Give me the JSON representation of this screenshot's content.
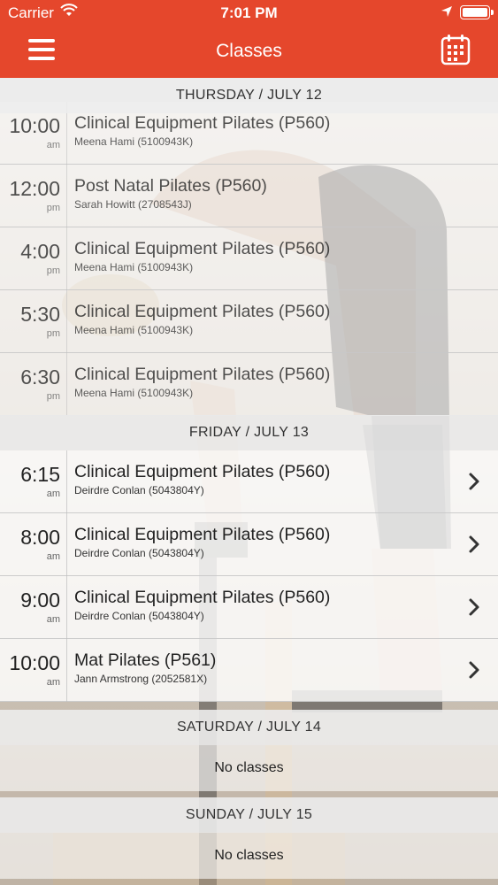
{
  "status_bar": {
    "carrier": "Carrier",
    "time": "7:01 PM"
  },
  "nav": {
    "title": "Classes",
    "accent_color": "#e5472c"
  },
  "icons": {
    "menu": "hamburger-menu-icon",
    "calendar": "calendar-icon",
    "wifi": "wifi-icon",
    "location": "location-arrow-icon",
    "battery": "battery-icon",
    "chevron": "chevron-right-icon"
  },
  "days": [
    {
      "header": "THURSDAY / JULY 12",
      "classes": [
        {
          "time": "10:00",
          "ampm": "am",
          "name": "Clinical Equipment Pilates (P560)",
          "instructor": "Meena Hami (5100943K)",
          "past": true
        },
        {
          "time": "12:00",
          "ampm": "pm",
          "name": "Post Natal Pilates (P560)",
          "instructor": "Sarah Howitt (2708543J)",
          "past": true
        },
        {
          "time": "4:00",
          "ampm": "pm",
          "name": "Clinical Equipment Pilates (P560)",
          "instructor": "Meena Hami (5100943K)",
          "past": true
        },
        {
          "time": "5:30",
          "ampm": "pm",
          "name": "Clinical Equipment Pilates (P560)",
          "instructor": "Meena Hami (5100943K)",
          "past": true
        },
        {
          "time": "6:30",
          "ampm": "pm",
          "name": "Clinical Equipment Pilates (P560)",
          "instructor": "Meena Hami (5100943K)",
          "past": true
        }
      ]
    },
    {
      "header": "FRIDAY / JULY 13",
      "classes": [
        {
          "time": "6:15",
          "ampm": "am",
          "name": "Clinical Equipment Pilates (P560)",
          "instructor": "Deirdre Conlan (5043804Y)",
          "past": false
        },
        {
          "time": "8:00",
          "ampm": "am",
          "name": "Clinical Equipment Pilates (P560)",
          "instructor": "Deirdre Conlan (5043804Y)",
          "past": false
        },
        {
          "time": "9:00",
          "ampm": "am",
          "name": "Clinical Equipment Pilates (P560)",
          "instructor": "Deirdre Conlan (5043804Y)",
          "past": false
        },
        {
          "time": "10:00",
          "ampm": "am",
          "name": "Mat Pilates (P561)",
          "instructor": "Jann Armstrong (2052581X)",
          "past": false
        }
      ]
    },
    {
      "header": "SATURDAY / JULY 14",
      "empty_text": "No classes"
    },
    {
      "header": "SUNDAY / JULY 15",
      "empty_text": "No classes"
    }
  ]
}
